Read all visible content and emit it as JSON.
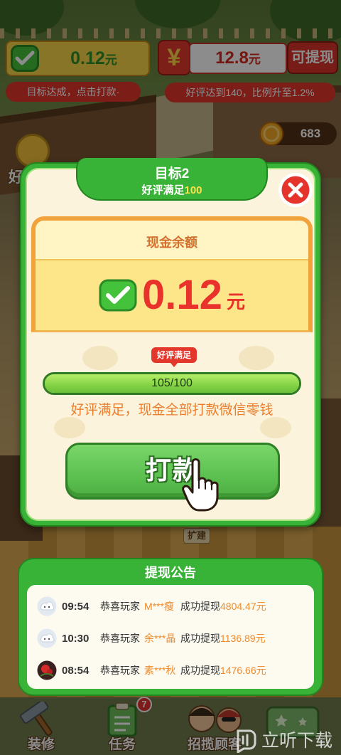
{
  "theme": {
    "frame_green": "#39b238",
    "tip_red": "#e2362b",
    "amount_red": "#e8322b",
    "hint_orange": "#ea7d2c",
    "name_orange": "#f08a2a"
  },
  "hud": {
    "wallet": {
      "icon": "wechat-icon",
      "amount": "0.12",
      "unit": "元"
    },
    "wallet_tip": "目标达成，点击打款·",
    "cash": {
      "icon": "yuan-icon",
      "symbol": "¥",
      "amount": "12.8",
      "unit": "元",
      "withdraw_label": "可提现"
    },
    "cash_tip": "好评达到140，比例升至1.2%",
    "coins": {
      "icon": "coin-icon",
      "count": "683"
    }
  },
  "background": {
    "left_sign": "好",
    "expand_label": "扩建"
  },
  "modal": {
    "title": "目标2",
    "subtitle_prefix": "好评满足",
    "subtitle_value": "100",
    "close_icon": "close-icon",
    "balance_title": "现金余额",
    "balance_icon": "wechat-icon",
    "balance_amount": "0.12",
    "balance_unit": "元",
    "progress_tag": "好评满足",
    "progress": {
      "current": 105,
      "target": 100,
      "label": "105/100"
    },
    "hint": "好评满足，现金全部打款微信零钱",
    "payout_label": "打款",
    "pointer_icon": "hand-pointer-icon"
  },
  "announcements": {
    "title": "提现公告",
    "rows": [
      {
        "avatar": "cloud-avatar",
        "time": "09:54",
        "prefix": "恭喜玩家",
        "player": "M***瘦",
        "action": "成功提现",
        "amount": "4804.47元"
      },
      {
        "avatar": "cloud-avatar",
        "time": "10:30",
        "prefix": "恭喜玩家",
        "player": "余***晶",
        "action": "成功提现",
        "amount": "1136.89元"
      },
      {
        "avatar": "flower-photo-avatar",
        "time": "08:54",
        "prefix": "恭喜玩家",
        "player": "素***秋",
        "action": "成功提现",
        "amount": "1476.66元"
      }
    ]
  },
  "bottom_nav": [
    {
      "icon": "hammer-icon",
      "label": "装修"
    },
    {
      "icon": "task-icon",
      "label": "任务",
      "badge": "7"
    },
    {
      "icon": "customers-icon",
      "label": "招揽顾客"
    },
    {
      "icon": "shop-icon"
    }
  ],
  "watermark": "立听下载"
}
